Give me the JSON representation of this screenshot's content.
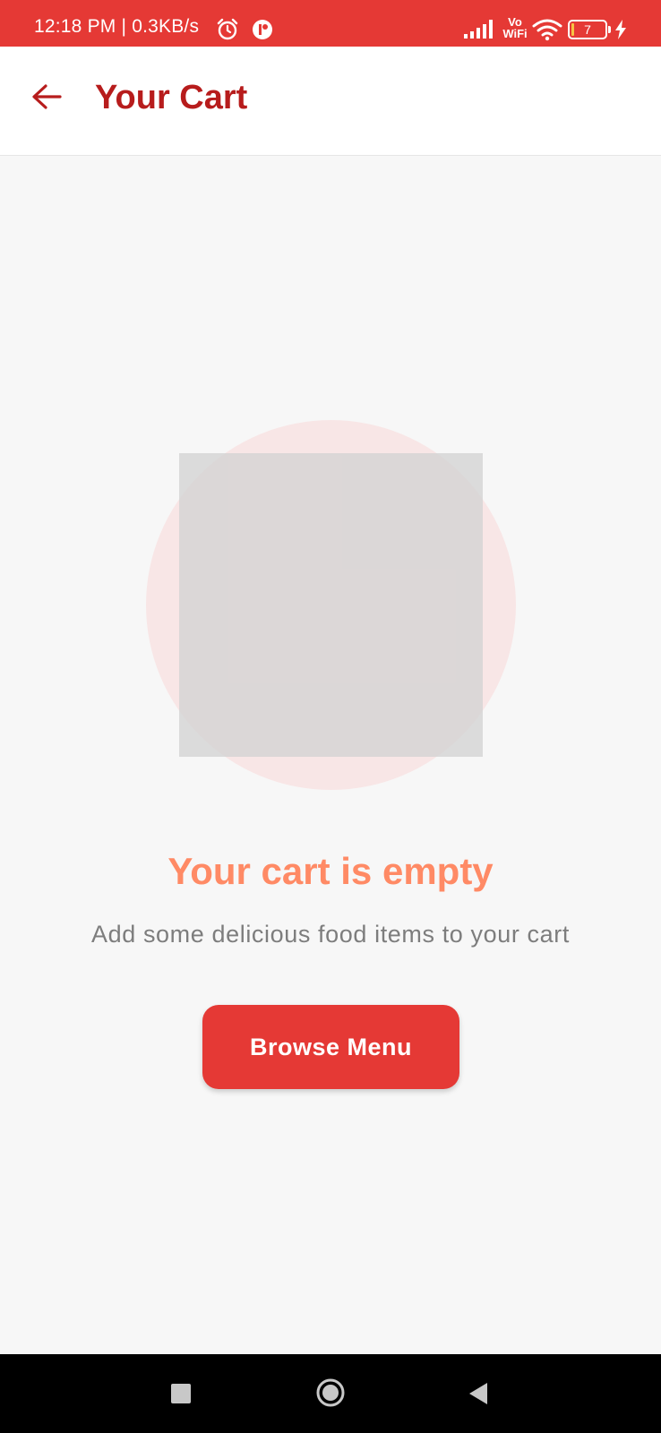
{
  "status_bar": {
    "time_speed": "12:18 PM | 0.3KB/s",
    "alarm_icon": "alarm-clock-icon",
    "app_notification_icon": "app-notification-icon",
    "signal_icon": "cell-signal-icon",
    "vowifi_line1": "Vo",
    "vowifi_line2": "WiFi",
    "wifi_icon": "wifi-icon",
    "battery_level": "7",
    "charging_icon": "charging-bolt-icon",
    "background_color": "#e53935"
  },
  "app_bar": {
    "back_icon": "arrow-left-icon",
    "title": "Your Cart",
    "title_color": "#b71c1c"
  },
  "empty_state": {
    "illustration": "empty-cart-image-placeholder",
    "title": "Your cart is empty",
    "title_color": "#ff8a65",
    "subtitle": "Add some delicious food items to your cart",
    "button_label": "Browse Menu",
    "button_color": "#e53935"
  },
  "nav_bar": {
    "recents_icon": "square-recents-icon",
    "home_icon": "circle-home-icon",
    "back_icon": "triangle-back-icon"
  }
}
